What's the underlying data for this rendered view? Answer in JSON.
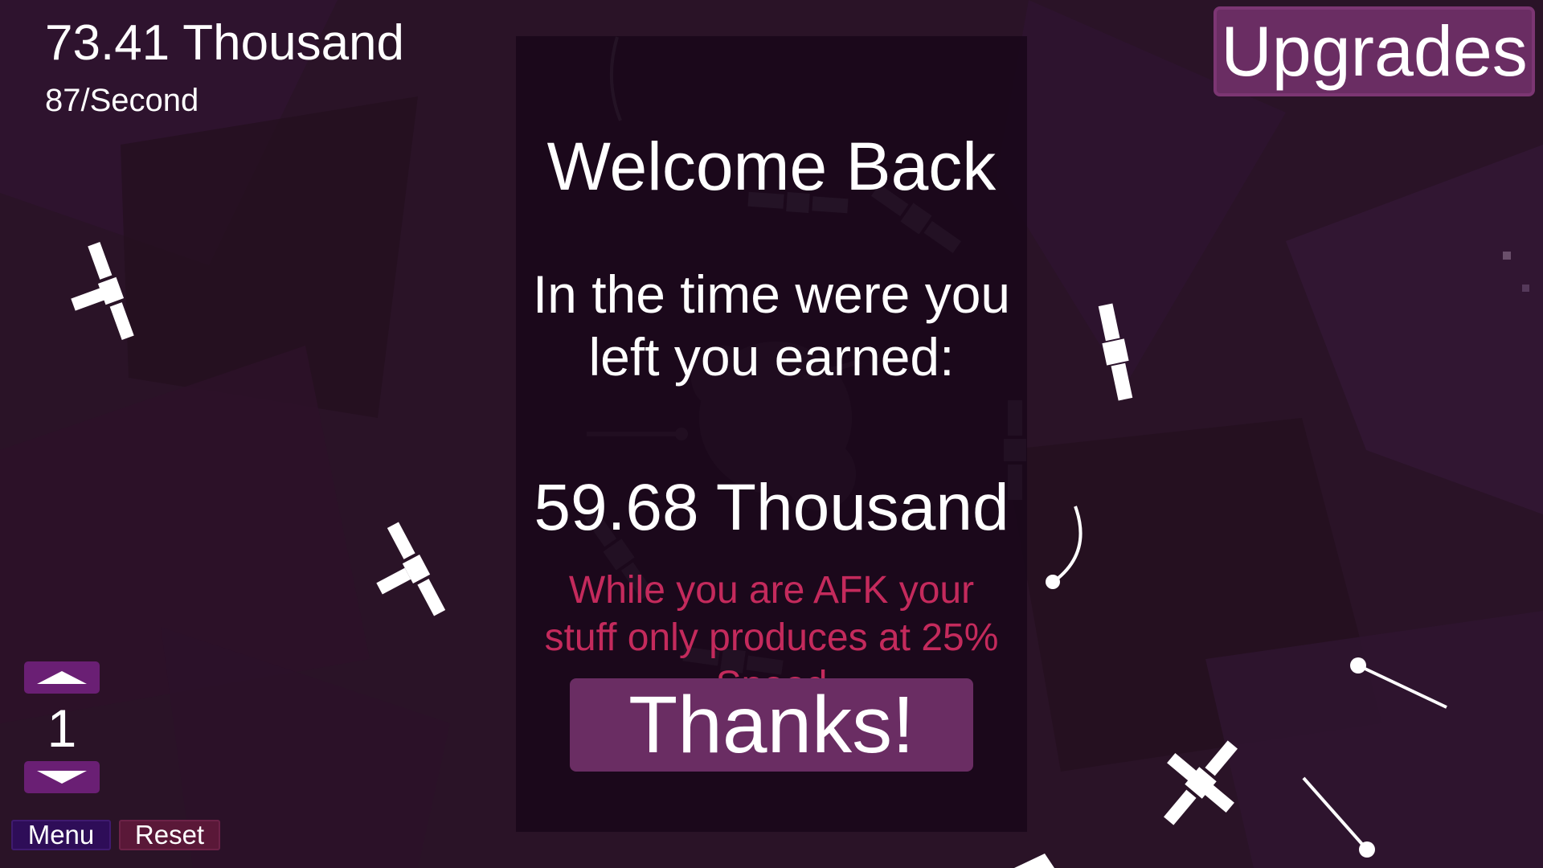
{
  "hud": {
    "total": "73.41 Thousand",
    "rate": "87/Second"
  },
  "upgrades_label": "Upgrades",
  "dialog": {
    "title": "Welcome Back",
    "subtitle": "In the time were you left you earned:",
    "earned": "59.68 Thousand",
    "note": "While you are AFK your stuff only produces at 25% Speed",
    "button_label": "Thanks!"
  },
  "level_selector": {
    "value": "1",
    "up_icon": "triangle-up-icon",
    "down_icon": "triangle-down-icon"
  },
  "footer": {
    "menu_label": "Menu",
    "reset_label": "Reset"
  },
  "colors": {
    "background": "#2a1327",
    "panel": "#18071a",
    "button": "#6a2d63",
    "warning_text": "#c42a5c",
    "arrow_button": "#6a1f74",
    "menu_button": "#2e0d58",
    "reset_button": "#5a1838"
  },
  "scene": {
    "planet_icon": "planet-icon",
    "satellite_icon": "satellite-icon",
    "meteor_icon": "meteor-icon"
  }
}
